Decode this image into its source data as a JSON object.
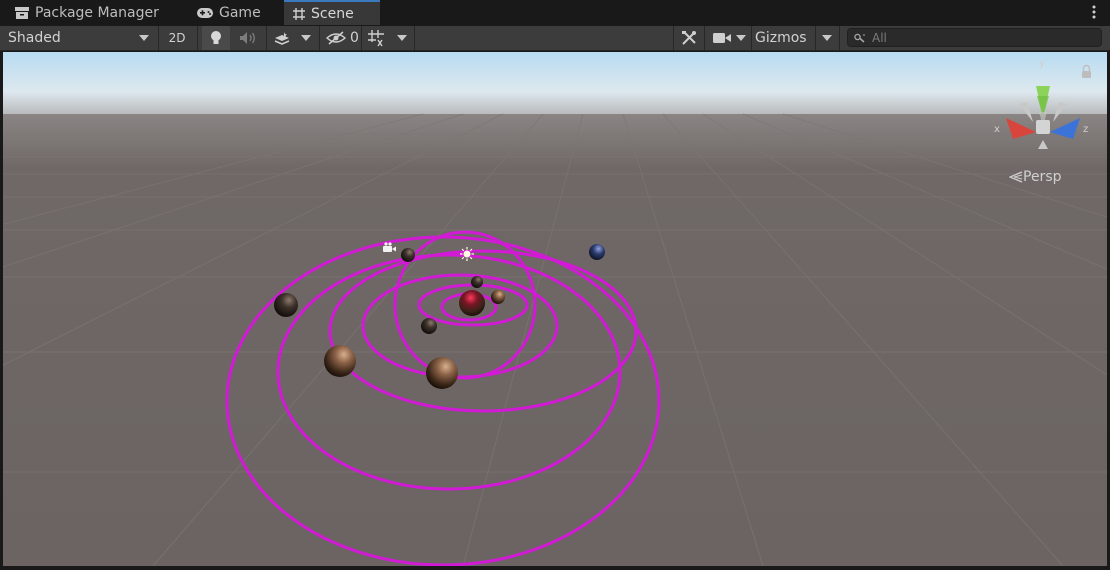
{
  "tabs": [
    {
      "label": "Package Manager",
      "icon": "package-icon"
    },
    {
      "label": "Game",
      "icon": "gamepad-icon"
    },
    {
      "label": "Scene",
      "icon": "grid-hash-icon"
    }
  ],
  "toolbar": {
    "draw_mode": "Shaded",
    "mode_2d": "2D",
    "hidden_count": "0",
    "gizmos_label": "Gizmos",
    "search_placeholder": "All"
  },
  "gizmo": {
    "x_label": "x",
    "y_label": "y",
    "z_label": "z",
    "projection": "Persp"
  },
  "colors": {
    "orbit": "#d21ad6",
    "tab_accent": "#3a79bb",
    "ground": "#6f6866",
    "sky_top": "#b8dcf2"
  }
}
